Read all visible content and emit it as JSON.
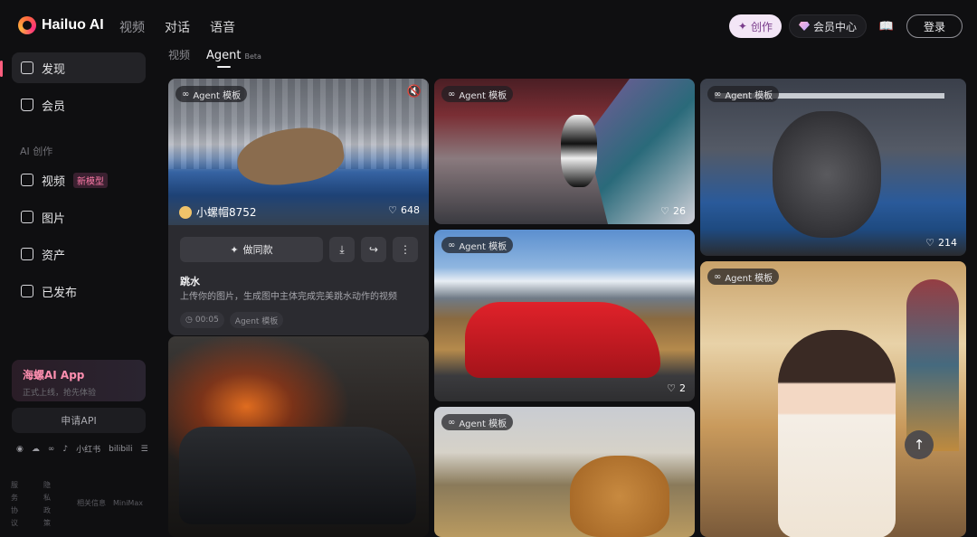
{
  "app": {
    "name": "Hailuo AI"
  },
  "topnav": [
    "视频",
    "对话",
    "语音"
  ],
  "topbar": {
    "create_label": "创作",
    "member_label": "会员中心",
    "login_label": "登录"
  },
  "sidebar": {
    "items": [
      {
        "label": "发现",
        "icon": "compass-icon"
      },
      {
        "label": "会员",
        "icon": "crown-icon"
      }
    ],
    "section_title": "AI 创作",
    "create_items": [
      {
        "label": "视频",
        "icon": "video-icon",
        "badge": "新模型"
      },
      {
        "label": "图片",
        "icon": "image-icon"
      },
      {
        "label": "资产",
        "icon": "folder-icon"
      },
      {
        "label": "已发布",
        "icon": "publish-icon"
      }
    ],
    "app_promo": {
      "title": "海螺AI App",
      "subtitle": "正式上线，抢先体验"
    },
    "api_label": "申请API",
    "social": [
      "wechat",
      "cloud",
      "meta",
      "tiktok",
      "小红书",
      "bilibili",
      "menu"
    ],
    "footer": {
      "col1": "服务协议",
      "col2": "隐私政策",
      "related": "相关信息",
      "brand": "MiniMax"
    }
  },
  "subtabs": {
    "video": "视频",
    "agent": "Agent",
    "beta": "Beta"
  },
  "cards": {
    "tag": "Agent 模板",
    "featured": {
      "author": "小螺帽8752",
      "likes": "648",
      "same_label": "做同款",
      "title": "跳水",
      "description": "上传你的图片，生成图中主体完成完美跳水动作的视频",
      "duration": "00:05",
      "category": "Agent 模板"
    },
    "panda_likes": "26",
    "car_likes": "2",
    "gorilla_likes": "214"
  }
}
